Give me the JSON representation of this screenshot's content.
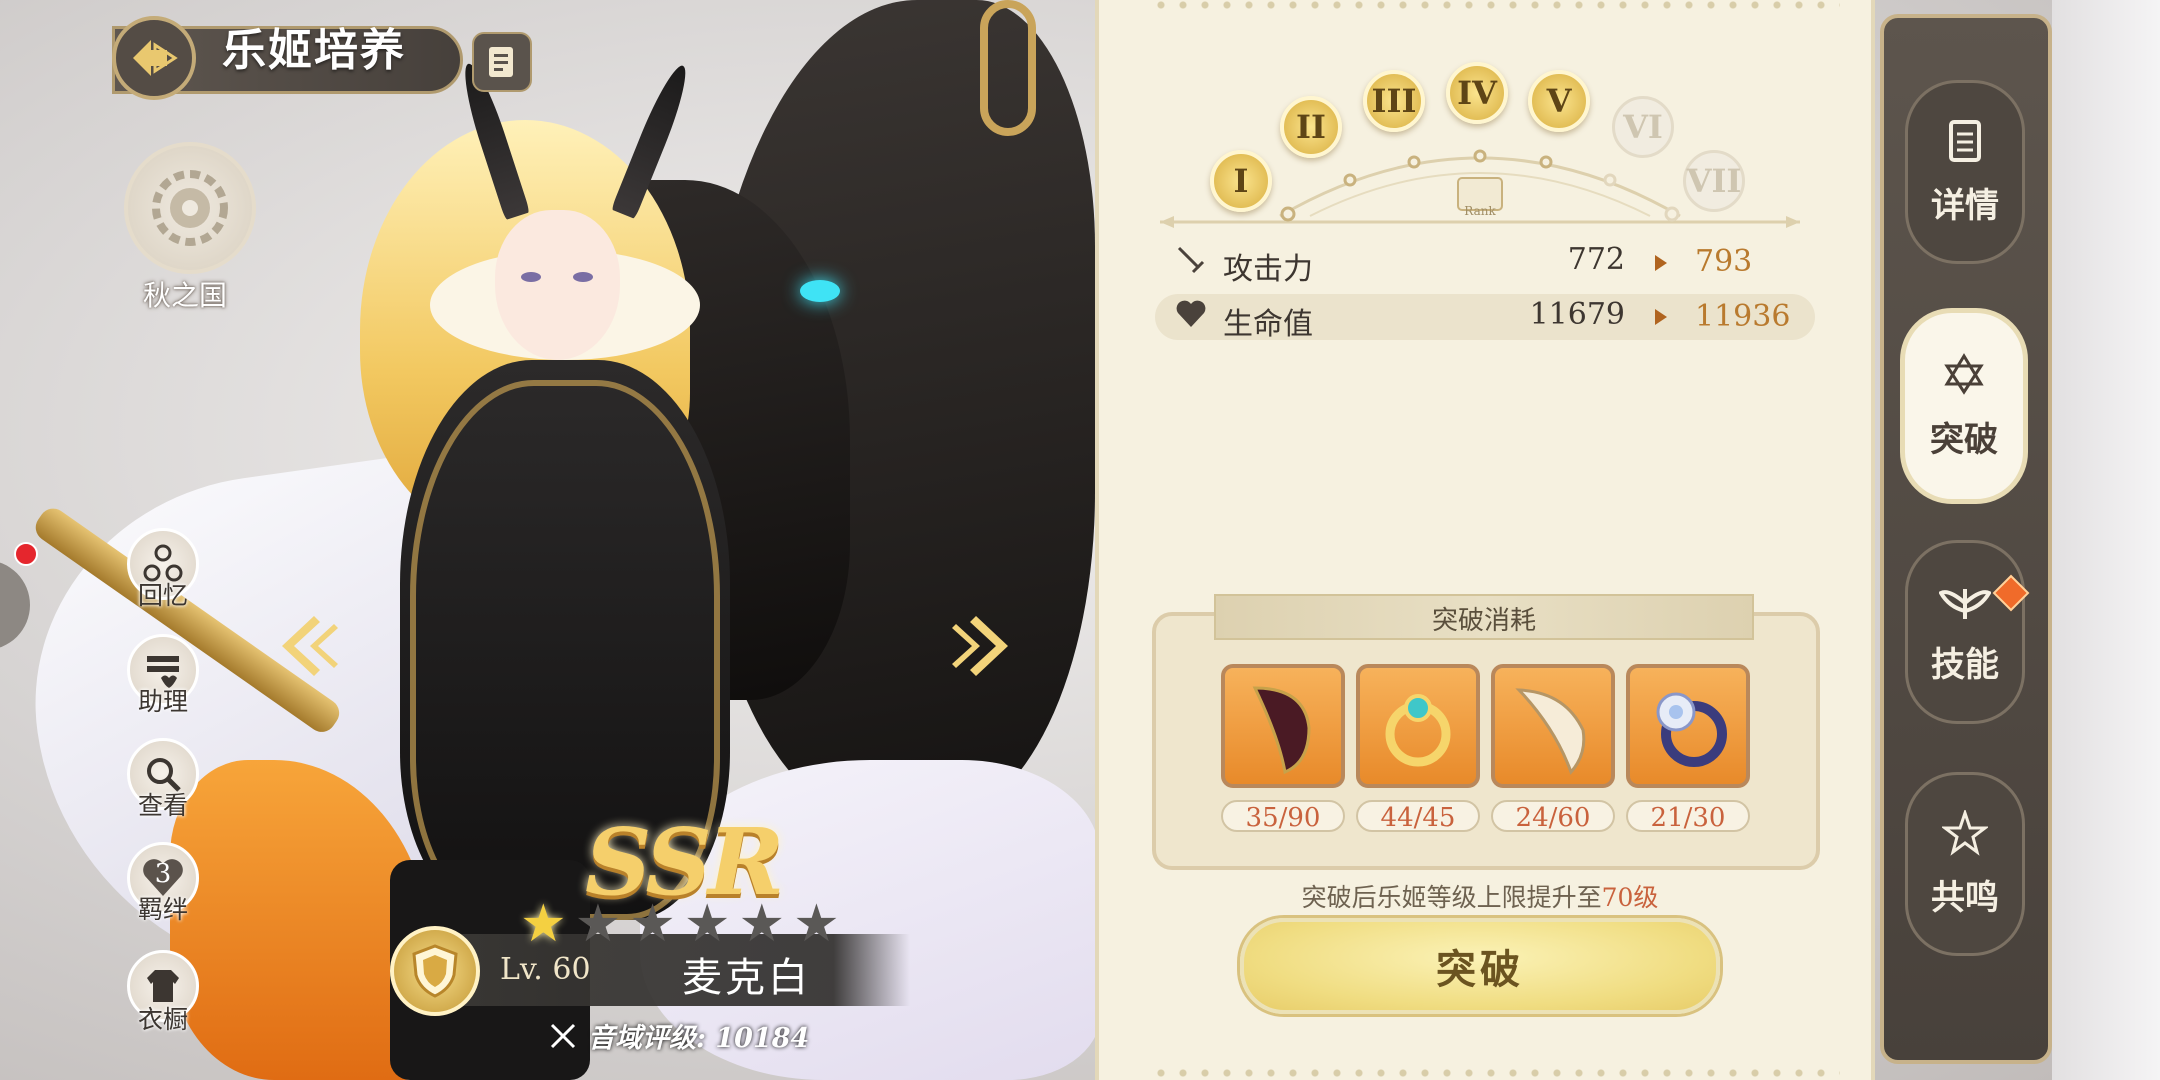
{
  "header": {
    "title": "乐姬培养"
  },
  "faction": {
    "label": "秋之国"
  },
  "side_menu": [
    {
      "label": "回忆",
      "icon": "triad-icon",
      "badge": true
    },
    {
      "label": "助理",
      "icon": "cabinet-icon"
    },
    {
      "label": "查看",
      "icon": "magnifier-icon"
    },
    {
      "label": "羁绊",
      "icon": "heart-icon",
      "count": "3"
    },
    {
      "label": "衣橱",
      "icon": "wardrobe-icon"
    }
  ],
  "character": {
    "rarity": "SSR",
    "stars_total": 6,
    "stars_filled": 1,
    "level": "Lv. 60",
    "name": "麦克白",
    "rating": "音域评级: 10184"
  },
  "rank": {
    "label": "Rank",
    "tiers": [
      {
        "numeral": "I",
        "active": true
      },
      {
        "numeral": "II",
        "active": true
      },
      {
        "numeral": "III",
        "active": true
      },
      {
        "numeral": "IV",
        "active": true
      },
      {
        "numeral": "V",
        "active": true
      },
      {
        "numeral": "VI",
        "active": false
      },
      {
        "numeral": "VII",
        "active": false
      }
    ]
  },
  "stats": [
    {
      "name": "攻击力",
      "icon": "sword-icon",
      "current": "772",
      "next": "793"
    },
    {
      "name": "生命值",
      "icon": "heart-icon",
      "current": "11679",
      "next": "11936"
    }
  ],
  "cost": {
    "title": "突破消耗",
    "items": [
      {
        "name": "dark-claw",
        "count": "35/90"
      },
      {
        "name": "gold-ring",
        "count": "44/45"
      },
      {
        "name": "ivory-fang",
        "count": "24/60"
      },
      {
        "name": "flower-ring",
        "count": "21/30"
      }
    ]
  },
  "note": {
    "prefix": "突破后乐姬等级上限提升至",
    "value": "70级"
  },
  "action": {
    "label": "突破"
  },
  "tabs": [
    {
      "label": "详情",
      "icon": "scroll-icon",
      "active": false
    },
    {
      "label": "突破",
      "icon": "hexagram-icon",
      "active": true
    },
    {
      "label": "技能",
      "icon": "wings-icon",
      "active": false,
      "alert": true
    },
    {
      "label": "共鸣",
      "icon": "star-burst-icon",
      "active": false
    }
  ],
  "colors": {
    "accent_gold": "#f0dd82",
    "count_red": "#c9623d",
    "next_value": "#b97a2e",
    "rail": "#4e4740"
  }
}
